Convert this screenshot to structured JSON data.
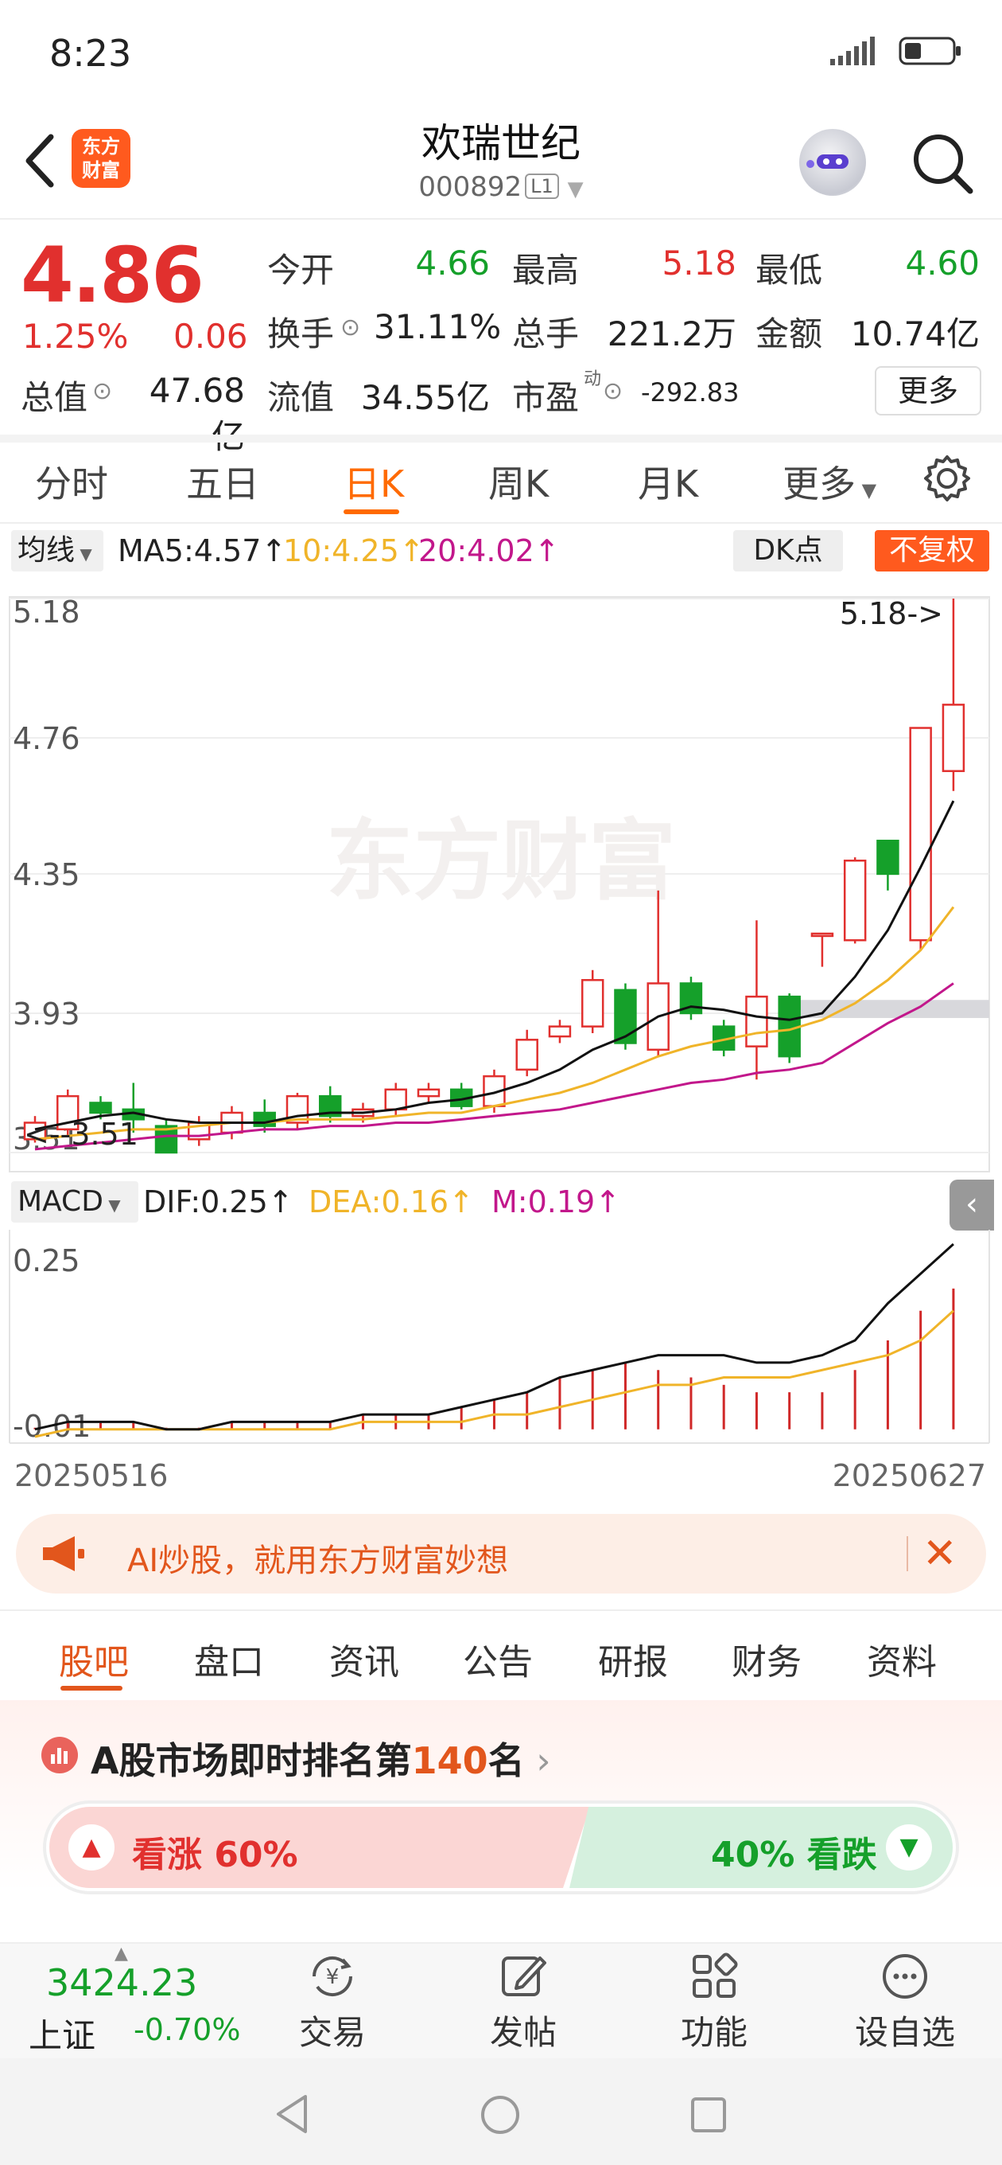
{
  "status": {
    "time": "8:23"
  },
  "header": {
    "title": "欢瑞世纪",
    "code": "000892",
    "level": "L1",
    "logo_line1": "东方",
    "logo_line2": "财富"
  },
  "quote": {
    "price": "4.86",
    "change_pct": "1.25%",
    "change": "0.06",
    "open_label": "今开",
    "open": "4.66",
    "high_label": "最高",
    "high": "5.18",
    "low_label": "最低",
    "low": "4.60",
    "turnover_label": "换手",
    "turnover": "31.11%",
    "volume_label": "总手",
    "volume": "221.2万",
    "amount_label": "金额",
    "amount": "10.74亿",
    "mcap_label": "总值",
    "mcap": "47.68亿",
    "float_label": "流值",
    "float_mcap": "34.55亿",
    "pe_label": "市盈",
    "pe_sup": "动",
    "pe": "-292.83",
    "more": "更多"
  },
  "period_tabs": [
    "分时",
    "五日",
    "日K",
    "周K",
    "月K",
    "更多"
  ],
  "ma_bar": {
    "select": "均线",
    "ma5": "MA5:4.57↑",
    "ma10": "10:4.25↑",
    "ma20": "20:4.02↑",
    "dk": "DK点",
    "fq": "不复权"
  },
  "macd_bar": {
    "select": "MACD",
    "dif": "DIF:0.25↑",
    "dea": "DEA:0.16↑",
    "m": "M:0.19↑"
  },
  "chart_data": {
    "type": "candlestick",
    "y_ticks": [
      "5.18",
      "4.76",
      "4.35",
      "3.93",
      "3.51"
    ],
    "ylim": [
      3.51,
      5.18
    ],
    "high_annotation": "5.18->",
    "low_annotation": "<--3.51",
    "watermark": "东方财富",
    "colors": {
      "up": "#e1302e",
      "down": "#15a02a",
      "ma5": "#111111",
      "ma10": "#f0b429",
      "ma20": "#c2178b"
    },
    "candles": [
      {
        "o": 3.55,
        "c": 3.6,
        "h": 3.62,
        "l": 3.54
      },
      {
        "o": 3.58,
        "c": 3.68,
        "h": 3.7,
        "l": 3.56
      },
      {
        "o": 3.66,
        "c": 3.63,
        "h": 3.68,
        "l": 3.61
      },
      {
        "o": 3.64,
        "c": 3.61,
        "h": 3.72,
        "l": 3.57
      },
      {
        "o": 3.59,
        "c": 3.51,
        "h": 3.61,
        "l": 3.51
      },
      {
        "o": 3.55,
        "c": 3.6,
        "h": 3.62,
        "l": 3.53
      },
      {
        "o": 3.57,
        "c": 3.63,
        "h": 3.65,
        "l": 3.55
      },
      {
        "o": 3.63,
        "c": 3.59,
        "h": 3.67,
        "l": 3.57
      },
      {
        "o": 3.6,
        "c": 3.68,
        "h": 3.69,
        "l": 3.58
      },
      {
        "o": 3.68,
        "c": 3.62,
        "h": 3.71,
        "l": 3.6
      },
      {
        "o": 3.62,
        "c": 3.64,
        "h": 3.66,
        "l": 3.6
      },
      {
        "o": 3.64,
        "c": 3.7,
        "h": 3.72,
        "l": 3.62
      },
      {
        "o": 3.68,
        "c": 3.7,
        "h": 3.72,
        "l": 3.66
      },
      {
        "o": 3.7,
        "c": 3.65,
        "h": 3.72,
        "l": 3.64
      },
      {
        "o": 3.65,
        "c": 3.74,
        "h": 3.76,
        "l": 3.63
      },
      {
        "o": 3.76,
        "c": 3.85,
        "h": 3.88,
        "l": 3.74
      },
      {
        "o": 3.86,
        "c": 3.89,
        "h": 3.91,
        "l": 3.84
      },
      {
        "o": 3.89,
        "c": 4.03,
        "h": 4.06,
        "l": 3.87
      },
      {
        "o": 4.0,
        "c": 3.84,
        "h": 4.02,
        "l": 3.82
      },
      {
        "o": 3.82,
        "c": 4.02,
        "h": 4.3,
        "l": 3.8
      },
      {
        "o": 4.02,
        "c": 3.93,
        "h": 4.04,
        "l": 3.91
      },
      {
        "o": 3.89,
        "c": 3.82,
        "h": 3.91,
        "l": 3.8
      },
      {
        "o": 3.83,
        "c": 3.98,
        "h": 4.21,
        "l": 3.73
      },
      {
        "o": 3.98,
        "c": 3.8,
        "h": 3.99,
        "l": 3.78
      },
      {
        "o": 4.17,
        "c": 4.17,
        "h": 4.17,
        "l": 4.07
      },
      {
        "o": 4.15,
        "c": 4.39,
        "h": 4.4,
        "l": 4.14
      },
      {
        "o": 4.45,
        "c": 4.35,
        "h": 4.45,
        "l": 4.3
      },
      {
        "o": 4.15,
        "c": 4.79,
        "h": 4.79,
        "l": 4.12
      },
      {
        "o": 4.66,
        "c": 4.86,
        "h": 5.18,
        "l": 4.6
      }
    ],
    "ma5": [
      3.58,
      3.6,
      3.62,
      3.63,
      3.61,
      3.6,
      3.6,
      3.6,
      3.62,
      3.63,
      3.63,
      3.64,
      3.66,
      3.67,
      3.69,
      3.72,
      3.76,
      3.82,
      3.86,
      3.92,
      3.95,
      3.94,
      3.92,
      3.91,
      3.93,
      4.04,
      4.18,
      4.37,
      4.57
    ],
    "ma10": [
      3.55,
      3.56,
      3.57,
      3.58,
      3.58,
      3.59,
      3.6,
      3.6,
      3.61,
      3.61,
      3.61,
      3.62,
      3.63,
      3.63,
      3.65,
      3.67,
      3.69,
      3.72,
      3.76,
      3.8,
      3.83,
      3.85,
      3.87,
      3.88,
      3.91,
      3.96,
      4.03,
      4.12,
      4.25
    ],
    "ma20": [
      3.52,
      3.53,
      3.54,
      3.55,
      3.56,
      3.56,
      3.57,
      3.58,
      3.58,
      3.59,
      3.59,
      3.6,
      3.6,
      3.61,
      3.62,
      3.63,
      3.64,
      3.66,
      3.68,
      3.7,
      3.72,
      3.73,
      3.75,
      3.76,
      3.78,
      3.84,
      3.9,
      3.95,
      4.02
    ],
    "macd": {
      "y_ticks": [
        "0.25",
        "-0.01"
      ],
      "ylim": [
        -0.01,
        0.25
      ],
      "dif": [
        0.0,
        0.01,
        0.01,
        0.01,
        0.0,
        0.0,
        0.01,
        0.01,
        0.01,
        0.01,
        0.02,
        0.02,
        0.02,
        0.03,
        0.04,
        0.05,
        0.07,
        0.08,
        0.09,
        0.1,
        0.1,
        0.1,
        0.09,
        0.09,
        0.1,
        0.12,
        0.17,
        0.21,
        0.25
      ],
      "dea": [
        -0.01,
        0.0,
        0.0,
        0.0,
        0.0,
        0.0,
        0.0,
        0.0,
        0.0,
        0.0,
        0.01,
        0.01,
        0.01,
        0.01,
        0.02,
        0.02,
        0.03,
        0.04,
        0.05,
        0.06,
        0.06,
        0.07,
        0.07,
        0.07,
        0.08,
        0.09,
        0.1,
        0.12,
        0.16
      ],
      "m": [
        0.0,
        0.01,
        0.01,
        0.01,
        0.0,
        0.0,
        0.01,
        0.01,
        0.01,
        0.01,
        0.02,
        0.02,
        0.02,
        0.03,
        0.04,
        0.05,
        0.07,
        0.08,
        0.09,
        0.08,
        0.07,
        0.06,
        0.05,
        0.05,
        0.05,
        0.08,
        0.12,
        0.16,
        0.19
      ]
    },
    "date_start": "20250516",
    "date_end": "20250627"
  },
  "banner": {
    "text": "AI炒股，就用东方财富妙想"
  },
  "bottom_tabs": [
    "股吧",
    "盘口",
    "资讯",
    "公告",
    "研报",
    "财务",
    "资料"
  ],
  "rank": {
    "prefix": "A股市场即时排名第",
    "number": "140",
    "suffix": "名"
  },
  "vote": {
    "up": "看涨 60%",
    "down": "40% 看跌"
  },
  "index": {
    "value": "3424.23",
    "name": "上证",
    "pct": "-0.70%"
  },
  "tools": [
    "交易",
    "发帖",
    "功能",
    "设自选"
  ]
}
